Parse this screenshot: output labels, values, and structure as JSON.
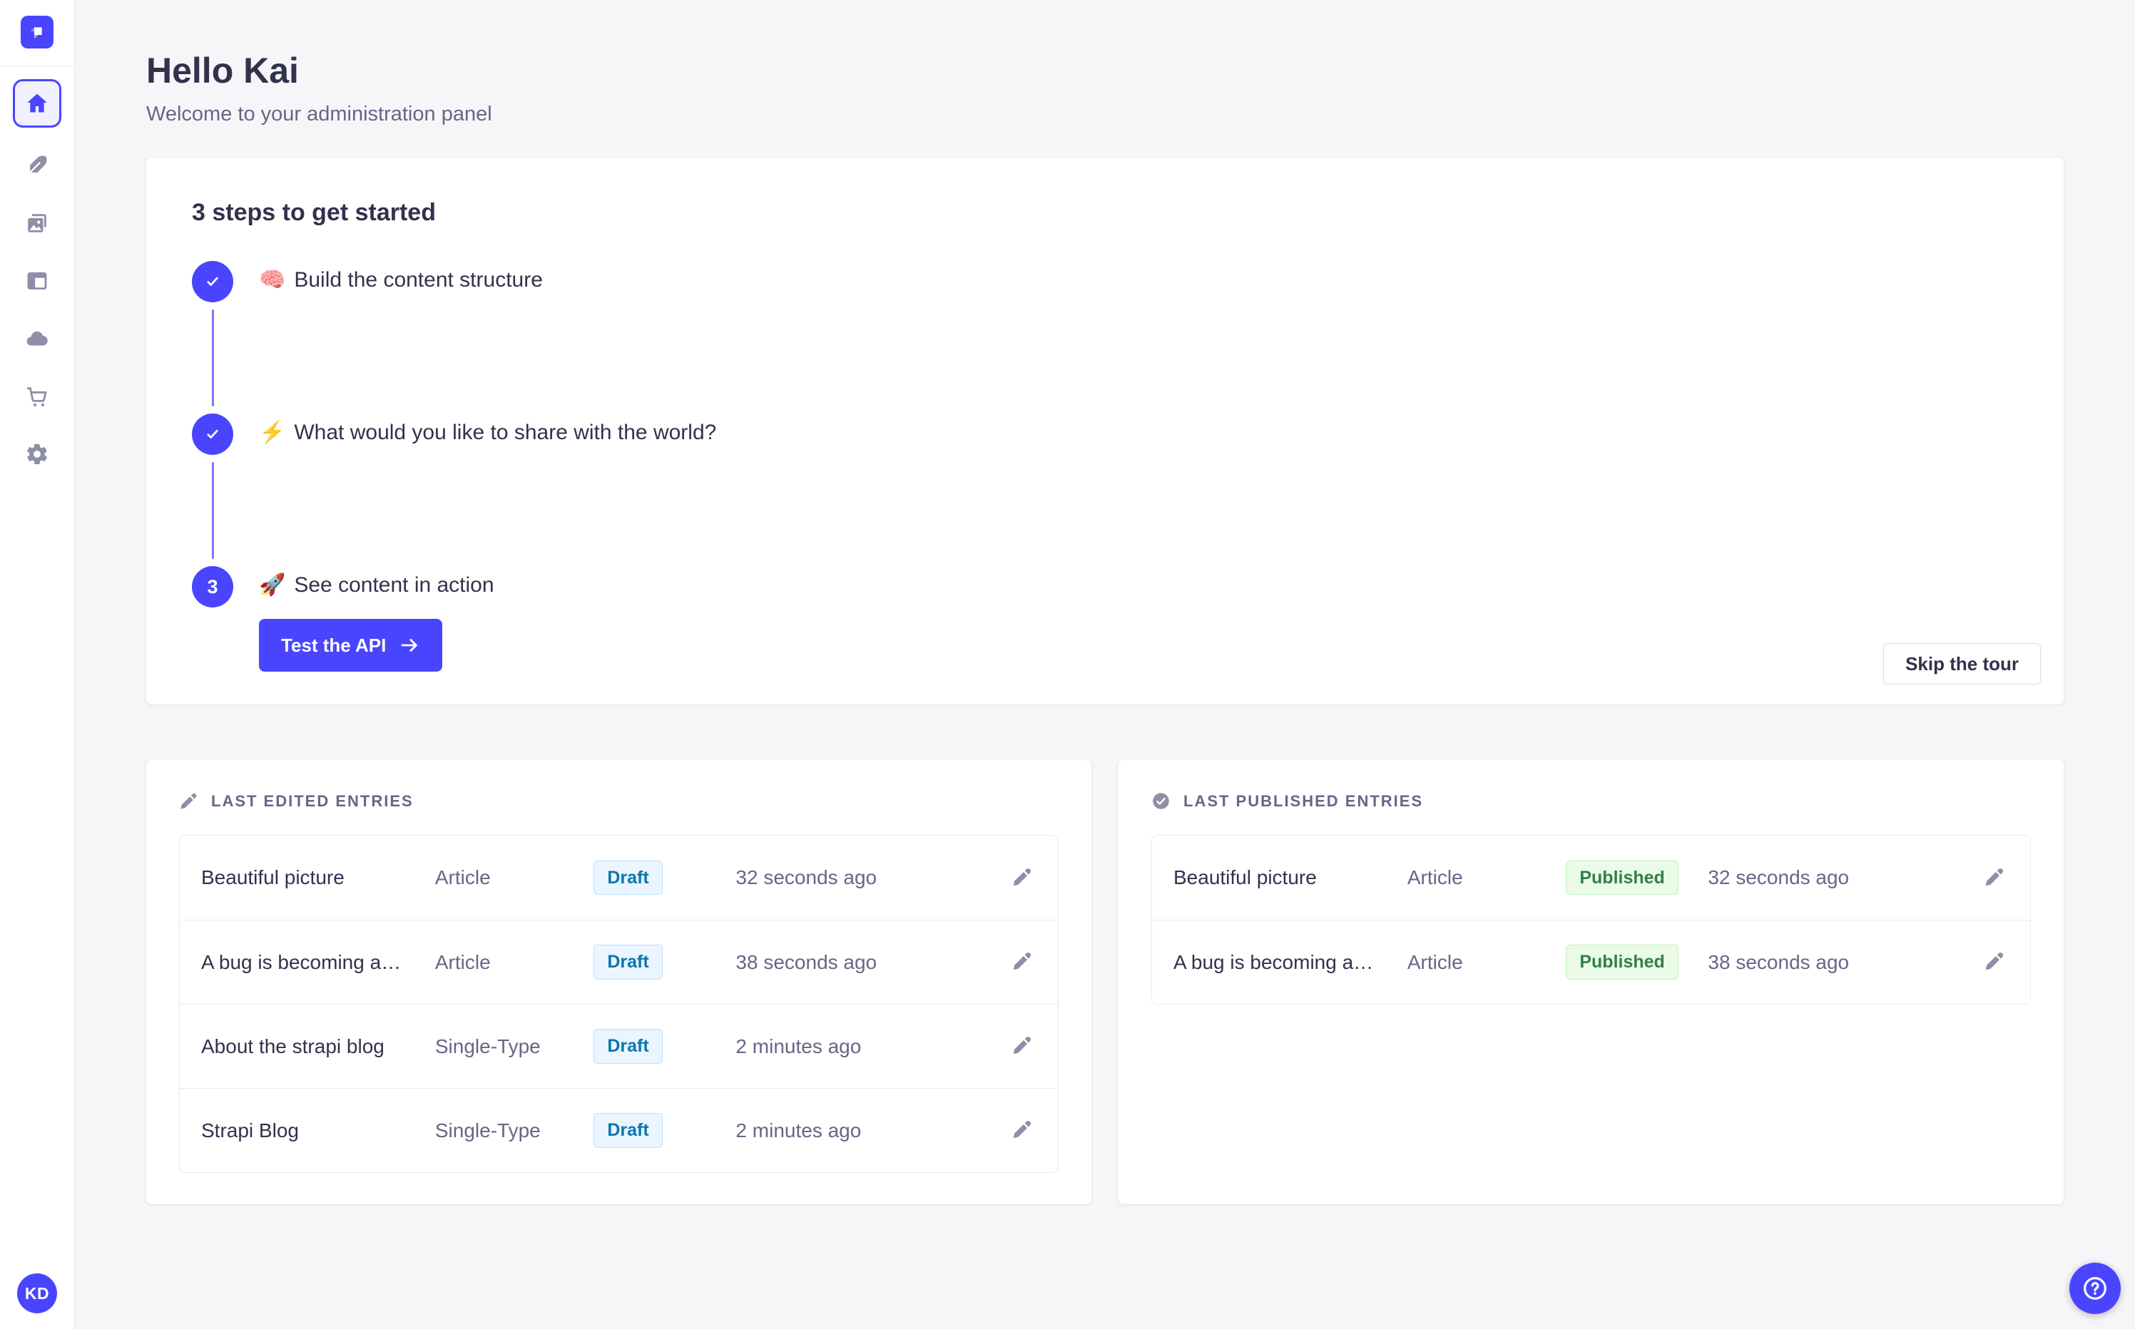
{
  "colors": {
    "primary": "#4945ff",
    "connector": "#7b79ff",
    "draft_text": "#0c75af",
    "published_text": "#328048",
    "background": "#f6f6f9"
  },
  "sidebar": {
    "icons": [
      "strapi-logo",
      "home",
      "content-manager-feather",
      "media-library-images",
      "content-type-builder-layout",
      "cloud",
      "marketplace-cart",
      "settings-gear"
    ],
    "avatar_initials": "KD"
  },
  "header": {
    "title": "Hello Kai",
    "subtitle": "Welcome to your administration panel"
  },
  "onboarding": {
    "title": "3 steps to get started",
    "steps": [
      {
        "emoji": "🧠",
        "label": "Build the content structure",
        "status": "done"
      },
      {
        "emoji": "⚡",
        "label": "What would you like to share with the world?",
        "status": "done"
      },
      {
        "emoji": "🚀",
        "label": "See content in action",
        "status": "current",
        "number": "3",
        "cta": "Test the API"
      }
    ],
    "skip_label": "Skip the tour"
  },
  "panels": {
    "edited": {
      "title": "LAST EDITED ENTRIES",
      "rows": [
        {
          "title": "Beautiful picture",
          "type": "Article",
          "status": "Draft",
          "time": "32 seconds ago"
        },
        {
          "title": "A bug is becoming a…",
          "type": "Article",
          "status": "Draft",
          "time": "38 seconds ago"
        },
        {
          "title": "About the strapi blog",
          "type": "Single-Type",
          "status": "Draft",
          "time": "2 minutes ago"
        },
        {
          "title": "Strapi Blog",
          "type": "Single-Type",
          "status": "Draft",
          "time": "2 minutes ago"
        }
      ]
    },
    "published": {
      "title": "LAST PUBLISHED ENTRIES",
      "rows": [
        {
          "title": "Beautiful picture",
          "type": "Article",
          "status": "Published",
          "time": "32 seconds ago"
        },
        {
          "title": "A bug is becoming a…",
          "type": "Article",
          "status": "Published",
          "time": "38 seconds ago"
        }
      ]
    }
  }
}
